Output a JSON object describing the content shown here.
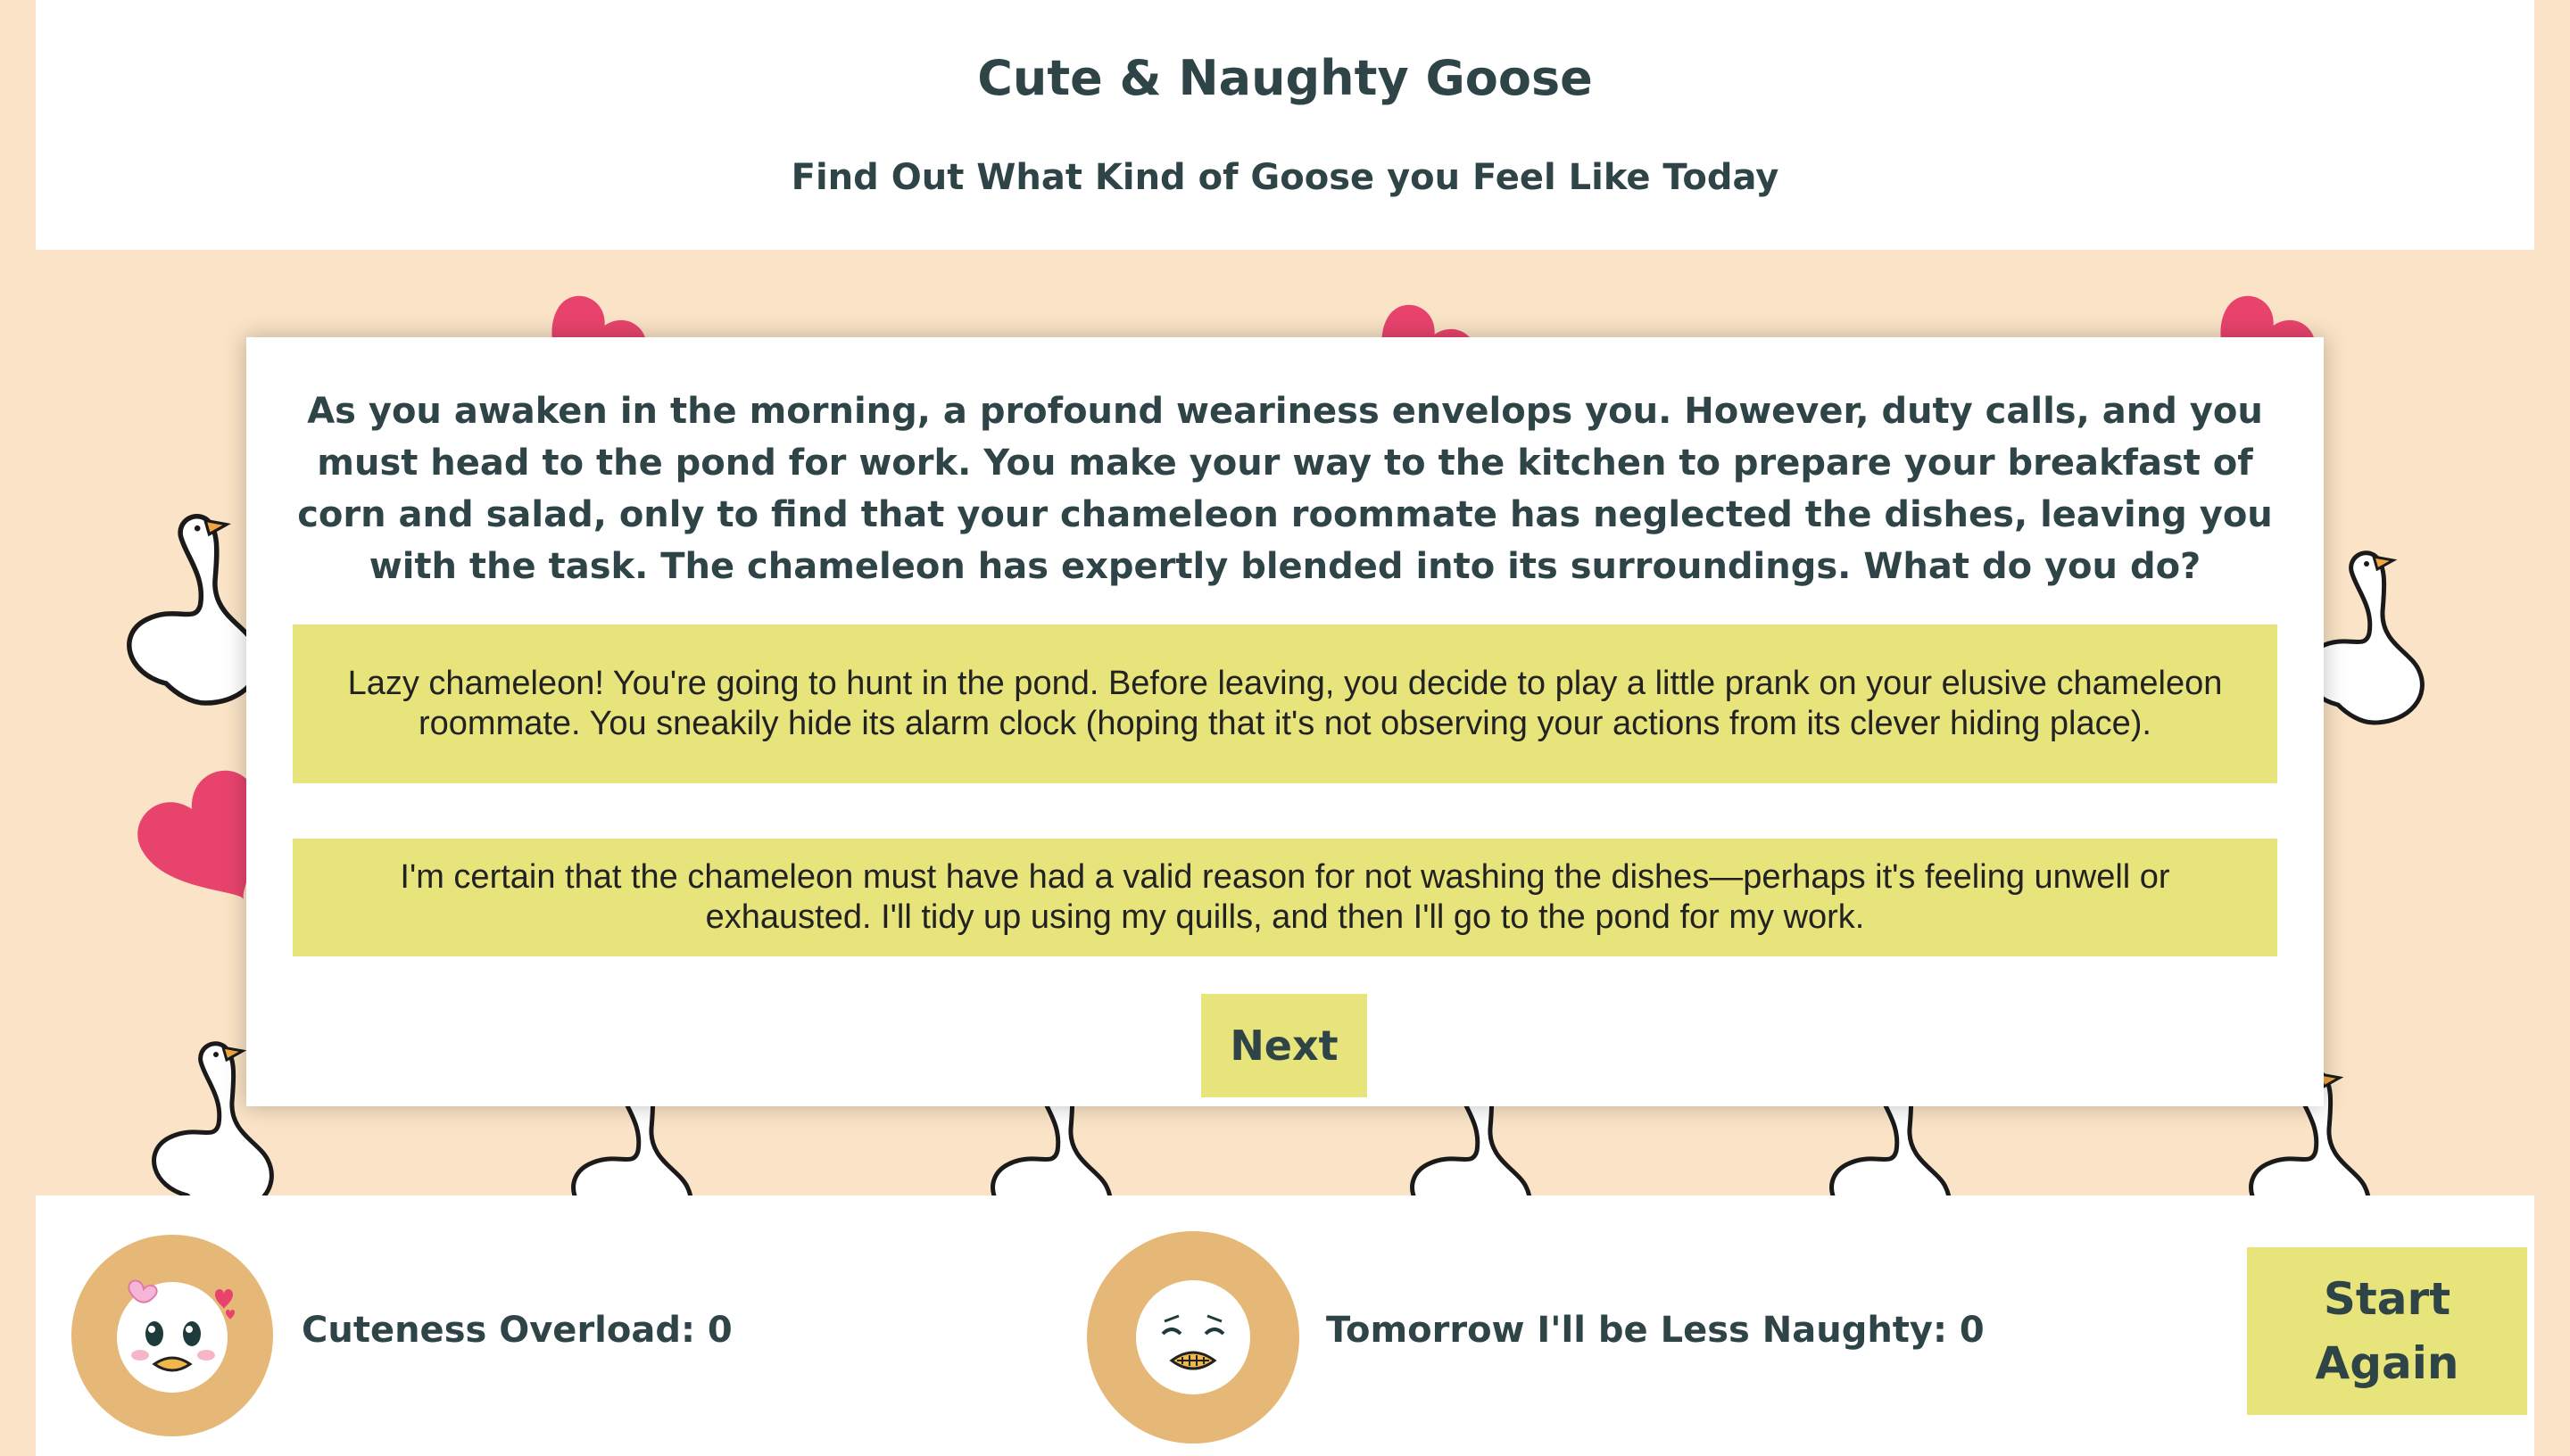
{
  "header": {
    "title": "Cute & Naughty Goose",
    "subtitle": "Find Out What Kind of Goose you Feel Like Today"
  },
  "question": {
    "text": "As you awaken in the morning, a profound weariness envelops you. However, duty calls, and you must head to the pond for work. You make your way to the kitchen to prepare your breakfast of corn and salad, only to find that your chameleon roommate has neglected the dishes, leaving you with the task. The chameleon has expertly blended into its surroundings. What do you do?",
    "answers": [
      "Lazy chameleon! You're going to hunt in the pond. Before leaving, you decide to play a little prank on your elusive chameleon roommate. You sneakily hide its alarm clock (hoping that it's not observing your actions from its clever hiding place).",
      "I'm certain that the chameleon must have had a valid reason for not washing the dishes—perhaps it's feeling unwell or exhausted. I'll tidy up using my quills, and then I'll go to the pond for my work."
    ],
    "next_label": "Next"
  },
  "footer": {
    "cute_score": "Cuteness Overload: 0",
    "naughty_score": "Tomorrow I'll be Less Naughty: 0",
    "start_again_label": "Start Again"
  },
  "colors": {
    "background": "#fae3c6",
    "panel": "#ffffff",
    "button": "#e8e47c",
    "heart": "#e8436d",
    "avatar_ring": "#e6b878",
    "text": "#2f4447"
  },
  "icons": {
    "background_pattern": [
      "goose-icon",
      "heart-icon"
    ],
    "cute_avatar": "cute-goose-face-icon",
    "naughty_avatar": "nervous-goose-face-icon"
  }
}
